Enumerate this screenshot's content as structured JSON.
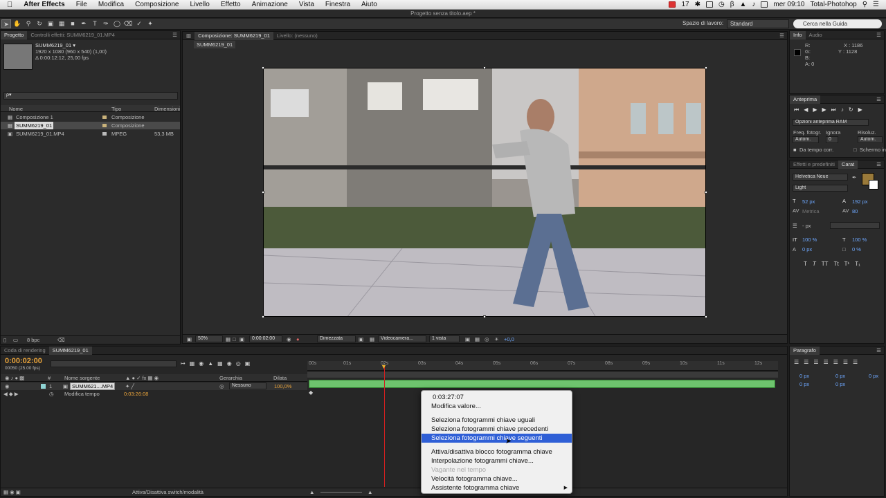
{
  "menubar": {
    "app_name": "After Effects",
    "items": [
      "File",
      "Modifica",
      "Composizione",
      "Livello",
      "Effetto",
      "Animazione",
      "Vista",
      "Finestra",
      "Aiuto"
    ],
    "status_count": "17",
    "clock": "mer 09:10",
    "user": "Total-Photohop"
  },
  "window_title": "Progetto senza titolo.aep *",
  "toolbar": {
    "workspace_label": "Spazio di lavoro:",
    "workspace_value": "Standard",
    "search_placeholder": "Cerca nella Guida"
  },
  "project": {
    "tab_project": "Progetto",
    "tab_effects": "Controlli effetti: SUMM6219_01.MP4",
    "item_name": "SUMM6219_01 ▾",
    "item_size": "1920 x 1080  (960 x 540) (1,00)",
    "item_duration": "Δ 0:00:12:12, 25,00 fps",
    "search_placeholder": "ρ▾",
    "col_name": "Nome",
    "col_type": "Tipo",
    "col_dim": "Dimensioni",
    "rows": [
      {
        "name": "Composizione 1",
        "type": "Composizione",
        "dim": ""
      },
      {
        "name": "SUMM6219_01",
        "type": "Composizione",
        "dim": ""
      },
      {
        "name": "SUMM6219_01.MP4",
        "type": "MPEG",
        "dim": "53,3 MB"
      }
    ],
    "bpc": "8 bpc"
  },
  "viewer": {
    "tab_comp": "Composizione: SUMM6219_01",
    "tab_layer": "Livello: (nessuno)",
    "breadcrumb": "SUMM6219_01",
    "zoom": "50%",
    "time": "0:00:02:00",
    "resolution": "Dimezzata",
    "camera": "Videocamera...",
    "views": "1 vista",
    "exposure": "+0,0"
  },
  "info": {
    "tab_info": "Info",
    "tab_audio": "Audio",
    "r": "R:",
    "g": "G:",
    "b": "B:",
    "a": "A:  0",
    "x": "X : 1186",
    "y": "Y : 1128"
  },
  "preview": {
    "title": "Anteprima",
    "ram_options": "Opzioni anteprima RAM",
    "frame_rate_label": "Freq. fotogr.",
    "skip_label": "Ignora",
    "res_label": "Risoluz.",
    "rate_value": "Autom.",
    "skip_value": "0",
    "res_value": "Autom.",
    "from_current": "Da tempo corr.",
    "full_screen": "Schermo int."
  },
  "character": {
    "tab_effects": "Effetti e predefiniti",
    "tab_char": "Carat",
    "font": "Helvetica Neue",
    "style": "Light",
    "size": "52 px",
    "leading": "192 px",
    "kerning": "Metrica",
    "tracking": "80",
    "stroke": "- px",
    "vscale": "100 %",
    "hscale": "100 %",
    "baseline": "0 px",
    "tsume": "0 %"
  },
  "paragraph": {
    "title": "Paragrafo",
    "indent1": "0 px",
    "indent2": "0 px",
    "indent3": "0 px",
    "space1": "0 px",
    "space2": "0 px"
  },
  "timeline": {
    "tab_render": "Coda di rendering",
    "tab_comp": "SUMM6219_01",
    "timecode": "0:00:02:00",
    "frames": "00050 (25.00 fps)",
    "col_num": "#",
    "col_source": "Nome sorgente",
    "col_parent": "Gerarchia",
    "col_stretch": "Dilata",
    "layer_num": "1",
    "layer_name": "SUMM621....MP4",
    "parent_value": "Nessuno",
    "stretch_value": "100,0%",
    "prop_name": "Modifica tempo",
    "prop_value": "0:03:26:08",
    "toggle_label": "Attiva/Disattiva switch/modalità",
    "ticks": [
      "00s",
      "01s",
      "02s",
      "03s",
      "04s",
      "05s",
      "06s",
      "07s",
      "08s",
      "09s",
      "10s",
      "11s",
      "12s"
    ]
  },
  "context_menu": {
    "header_value": "0:03:27:07",
    "items": [
      {
        "label": "Modifica valore...",
        "state": "normal"
      },
      {
        "label": "Seleziona fotogrammi chiave uguali",
        "state": "normal"
      },
      {
        "label": "Seleziona fotogrammi chiave precedenti",
        "state": "normal"
      },
      {
        "label": "Seleziona fotogrammi chiave seguenti",
        "state": "highlighted"
      },
      {
        "label": "Attiva/disattiva blocco fotogramma chiave",
        "state": "normal"
      },
      {
        "label": "Interpolazione fotogrammi chiave...",
        "state": "normal"
      },
      {
        "label": "Vagante nel tempo",
        "state": "disabled"
      },
      {
        "label": "Velocità fotogramma chiave...",
        "state": "normal"
      },
      {
        "label": "Assistente fotogramma chiave",
        "state": "submenu"
      }
    ]
  }
}
